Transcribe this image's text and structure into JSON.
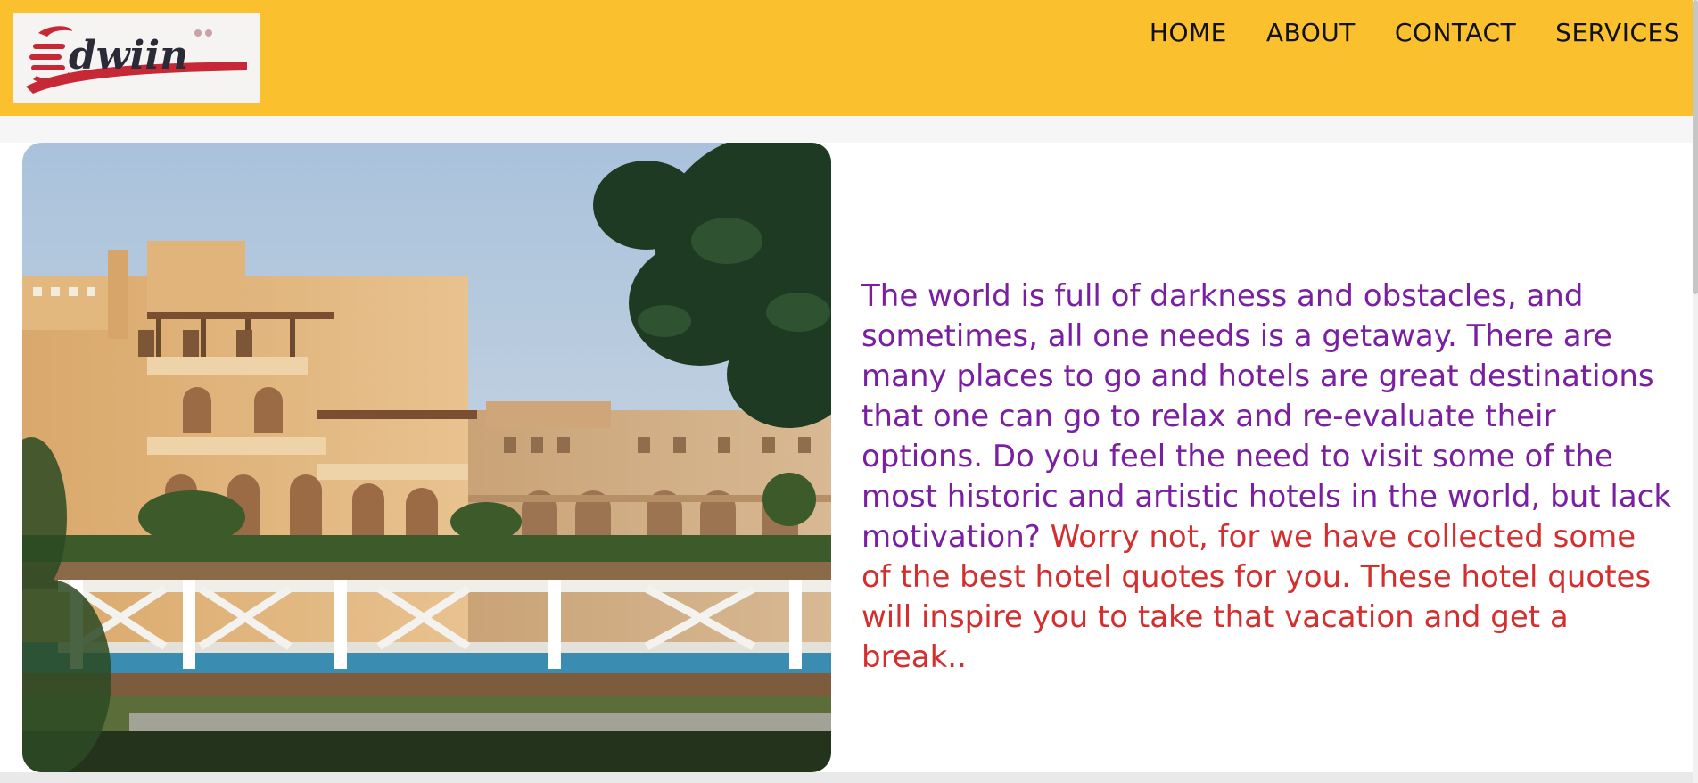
{
  "header": {
    "logo_text": "edwiin",
    "nav": [
      {
        "label": "HOME"
      },
      {
        "label": "ABOUT"
      },
      {
        "label": "CONTACT"
      },
      {
        "label": "SERVICES"
      }
    ]
  },
  "main": {
    "image_alt": "Sunlit resort hotel buildings with white wooden bridge and palm foliage",
    "paragraph_purple": "The world is full of darkness and obstacles, and sometimes, all one needs is a getaway. There are many places to go and hotels are great destinations that one can go to relax and re-evaluate their options. Do you feel the need to visit some of the most historic and artistic hotels in the world, but lack motivation?",
    "paragraph_red": " Worry not, for we have collected some of the best hotel quotes for you. These hotel quotes will inspire you to take that vacation and get a break.."
  },
  "colors": {
    "header_bg": "#fbc02d",
    "text_purple": "#7b1fa2",
    "text_red": "#d32f2f",
    "logo_red": "#c62835"
  }
}
